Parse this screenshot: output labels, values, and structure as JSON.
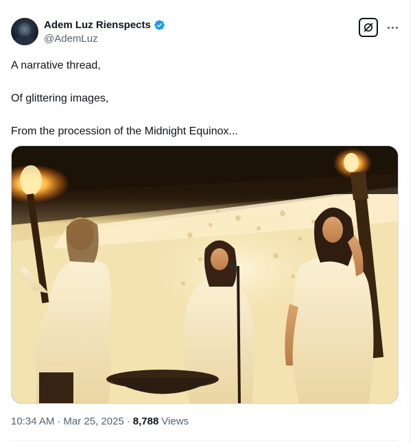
{
  "author": {
    "display_name": "Adem Luz Rienspects",
    "handle": "@AdemLuz",
    "verified": true,
    "avatar_icon": "profile-avatar"
  },
  "actions": {
    "grok_icon": "grok-icon",
    "more_icon": "more-horizontal-icon"
  },
  "tweet": {
    "lines": [
      "A narrative thread,",
      "Of glittering images,",
      "From the procession of the Midnight Equinox..."
    ]
  },
  "media": {
    "kind": "photo"
  },
  "meta": {
    "time": "10:34 AM",
    "separator": "·",
    "date": "Mar 25, 2025",
    "views_count": "8,788",
    "views_label": "Views"
  },
  "colors": {
    "text_primary": "#0f1419",
    "text_secondary": "#536471",
    "verified_blue": "#1d9bf0",
    "border": "#cfd9de"
  }
}
